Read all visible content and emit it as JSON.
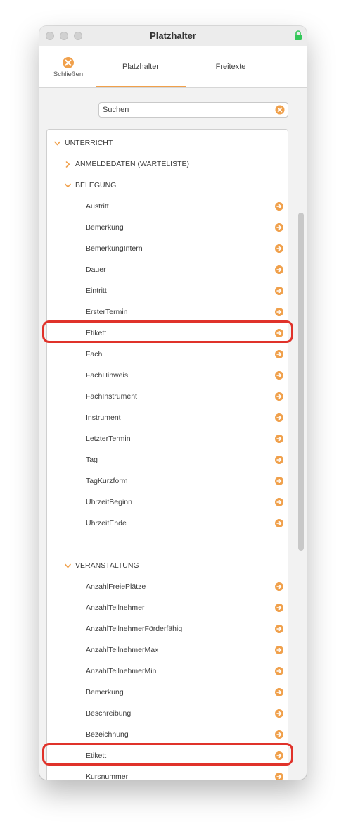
{
  "window": {
    "title": "Platzhalter"
  },
  "toolbar": {
    "close_label": "Schließen",
    "tabs": [
      {
        "label": "Platzhalter",
        "active": true
      },
      {
        "label": "Freitexte",
        "active": false
      }
    ]
  },
  "search": {
    "value": "Suchen"
  },
  "colors": {
    "accent": "#f0a04b",
    "highlight": "#e0322a",
    "lock": "#34c759"
  },
  "groups": {
    "unterricht": "UNTERRICHT",
    "anmeldedaten": "ANMELDEDATEN (WARTELISTE)",
    "belegung": "BELEGUNG",
    "veranstaltung": "VERANSTALTUNG"
  },
  "belegung_items": [
    "Austritt",
    "Bemerkung",
    "BemerkungIntern",
    "Dauer",
    "Eintritt",
    "ErsterTermin",
    "Etikett",
    "Fach",
    "FachHinweis",
    "FachInstrument",
    "Instrument",
    "LetzterTermin",
    "Tag",
    "TagKurzform",
    "UhrzeitBeginn",
    "UhrzeitEnde"
  ],
  "veranstaltung_items": [
    "AnzahlFreiePlätze",
    "AnzahlTeilnehmer",
    "AnzahlTeilnehmerFörderfähig",
    "AnzahlTeilnehmerMax",
    "AnzahlTeilnehmerMin",
    "Bemerkung",
    "Beschreibung",
    "Bezeichnung",
    "Etikett",
    "Kursnummer"
  ]
}
